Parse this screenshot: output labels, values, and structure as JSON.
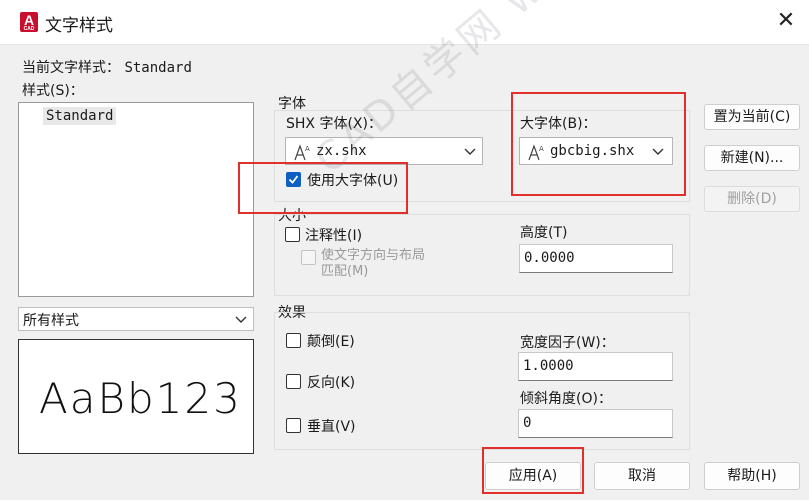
{
  "window": {
    "title": "文字样式",
    "app_icon_letter": "A",
    "app_icon_sub": "CAD",
    "close_glyph": "✕"
  },
  "current_style": {
    "label": "当前文字样式：",
    "value": "Standard"
  },
  "styles_panel": {
    "label": "样式(S)：",
    "items": [
      "Standard"
    ],
    "filter_value": "所有样式",
    "preview_text": "AaBb123"
  },
  "font_group": {
    "label": "字体",
    "shx_label": "SHX 字体(X)：",
    "shx_value": "zx.shx",
    "bigfont_label": "大字体(B)：",
    "bigfont_value": "gbcbig.shx",
    "use_bigfont_label": "使用大字体(U)",
    "use_bigfont_checked": true
  },
  "size_group": {
    "label": "大小",
    "annotative_label": "注释性(I)",
    "annotative_checked": false,
    "match_layout_line1": "使文字方向与布局",
    "match_layout_line2": "匹配(M)",
    "height_label": "高度(T)",
    "height_value": "0.0000"
  },
  "effects_group": {
    "label": "效果",
    "upside_down_label": "颠倒(E)",
    "backwards_label": "反向(K)",
    "vertical_label": "垂直(V)",
    "width_factor_label": "宽度因子(W)：",
    "width_factor_value": "1.0000",
    "oblique_label": "倾斜角度(O)：",
    "oblique_value": "0"
  },
  "buttons": {
    "set_current": "置为当前(C)",
    "new": "新建(N)...",
    "delete": "删除(D)",
    "apply": "应用(A)",
    "cancel": "取消",
    "help": "帮助(H)"
  },
  "watermark": "CAD自学网 www.cadzxw.com",
  "colors": {
    "accent": "#0f5fc2",
    "highlight": "#e0302c",
    "app_icon": "#c8102e"
  }
}
